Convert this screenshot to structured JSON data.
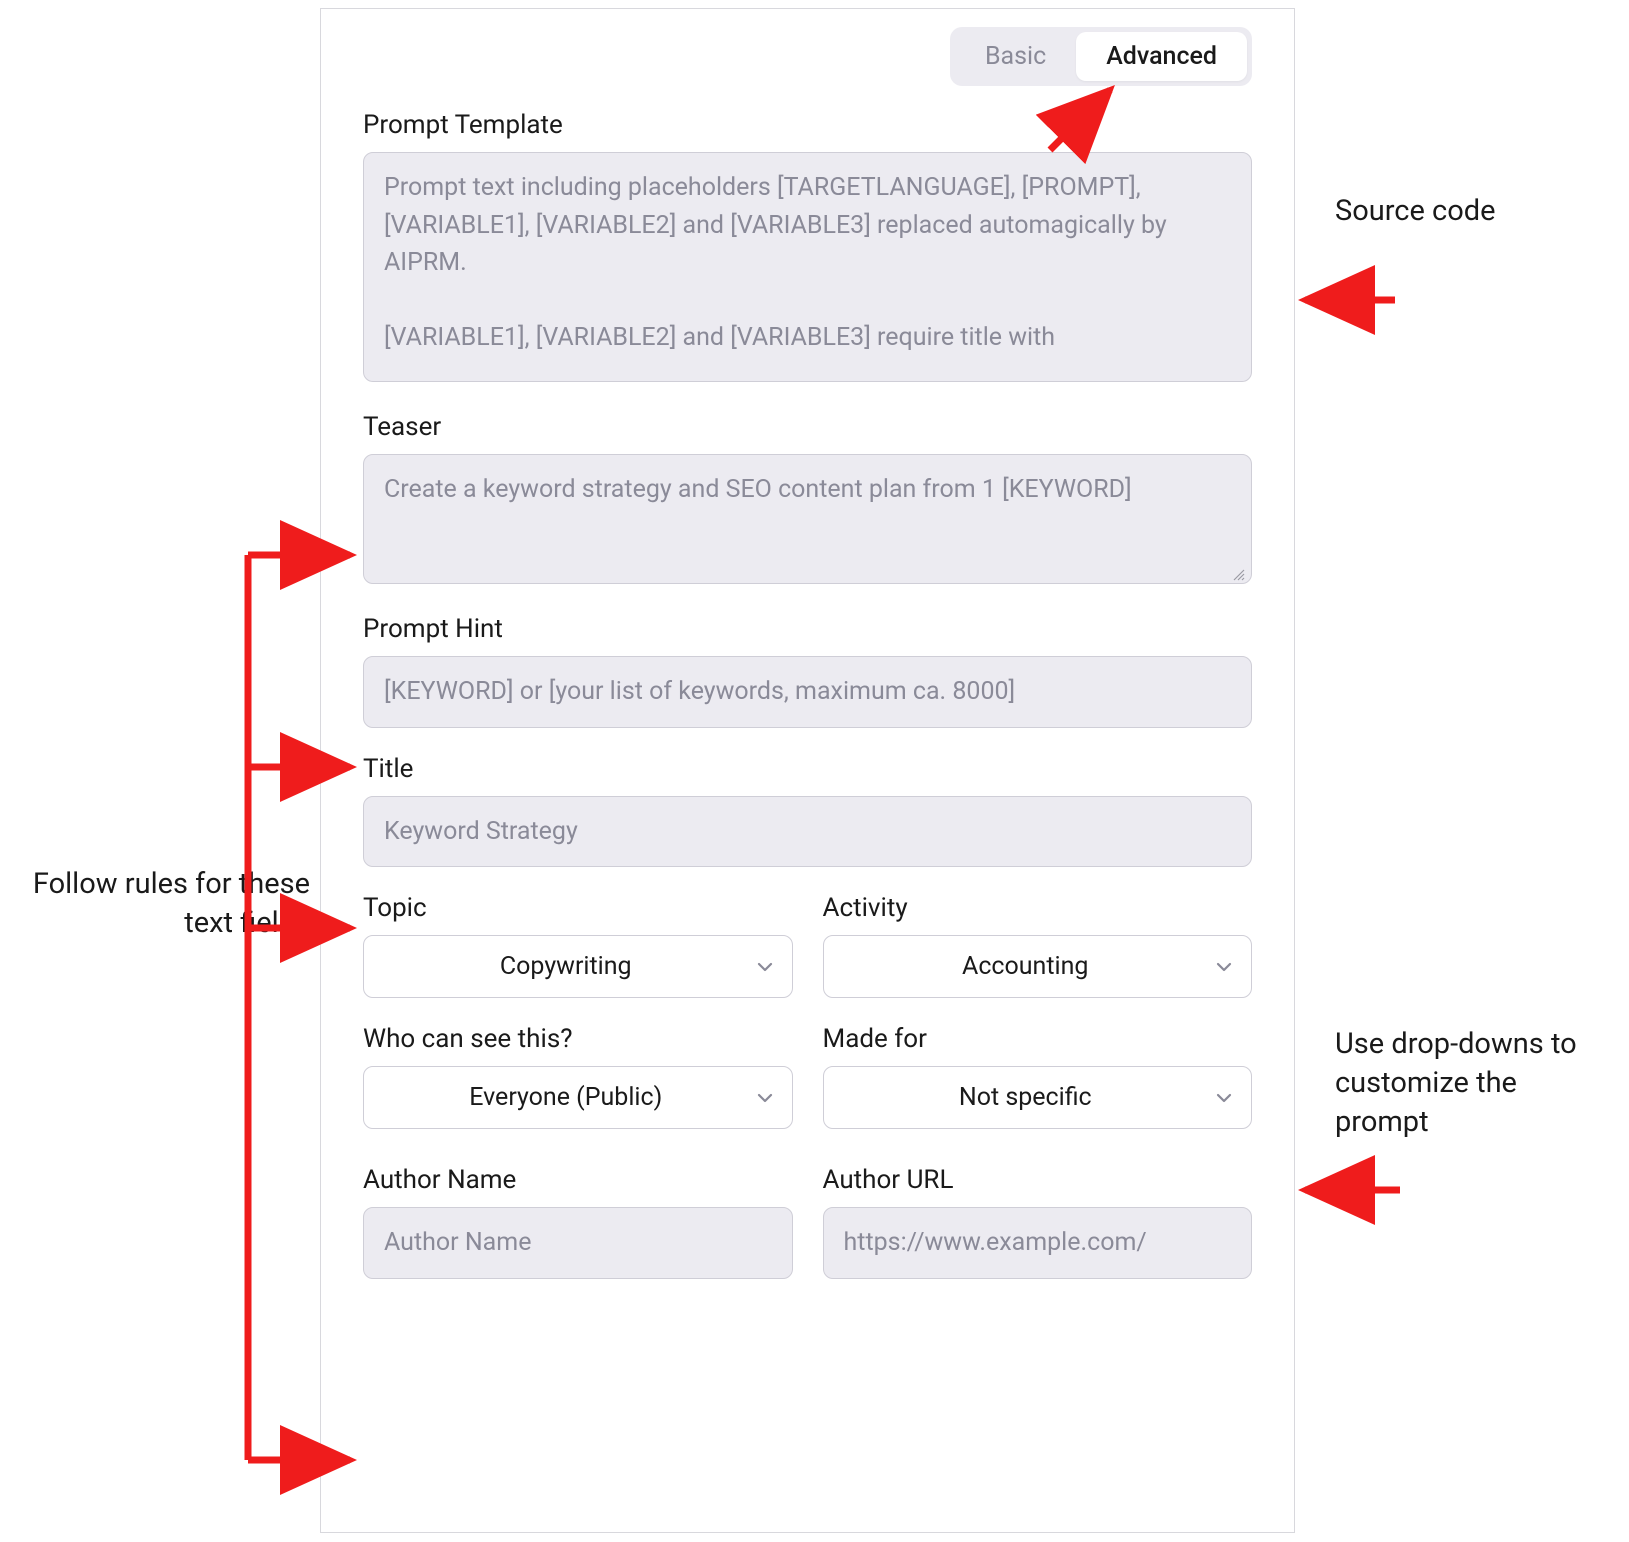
{
  "tabs": {
    "basic": "Basic",
    "advanced": "Advanced"
  },
  "prompt_template": {
    "label": "Prompt Template",
    "placeholder": "Prompt text including placeholders [TARGETLANGUAGE], [PROMPT], [VARIABLE1], [VARIABLE2] and [VARIABLE3] replaced automagically by AIPRM.\n\n[VARIABLE1], [VARIABLE2] and [VARIABLE3] require title with"
  },
  "teaser": {
    "label": "Teaser",
    "placeholder": "Create a keyword strategy and SEO content plan from 1 [KEYWORD]"
  },
  "prompt_hint": {
    "label": "Prompt Hint",
    "placeholder": "[KEYWORD] or [your list of keywords, maximum ca. 8000]"
  },
  "title": {
    "label": "Title",
    "placeholder": "Keyword Strategy"
  },
  "topic": {
    "label": "Topic",
    "value": "Copywriting"
  },
  "activity": {
    "label": "Activity",
    "value": "Accounting"
  },
  "visibility": {
    "label": "Who can see this?",
    "value": "Everyone (Public)"
  },
  "made_for": {
    "label": "Made for",
    "value": "Not specific"
  },
  "author_name": {
    "label": "Author Name",
    "placeholder": "Author Name"
  },
  "author_url": {
    "label": "Author URL",
    "placeholder": "https://www.example.com/"
  },
  "annotations": {
    "source_code": "Source code",
    "follow_rules": "Follow rules for these text fields",
    "use_dropdowns": "Use drop-downs to customize the prompt"
  }
}
